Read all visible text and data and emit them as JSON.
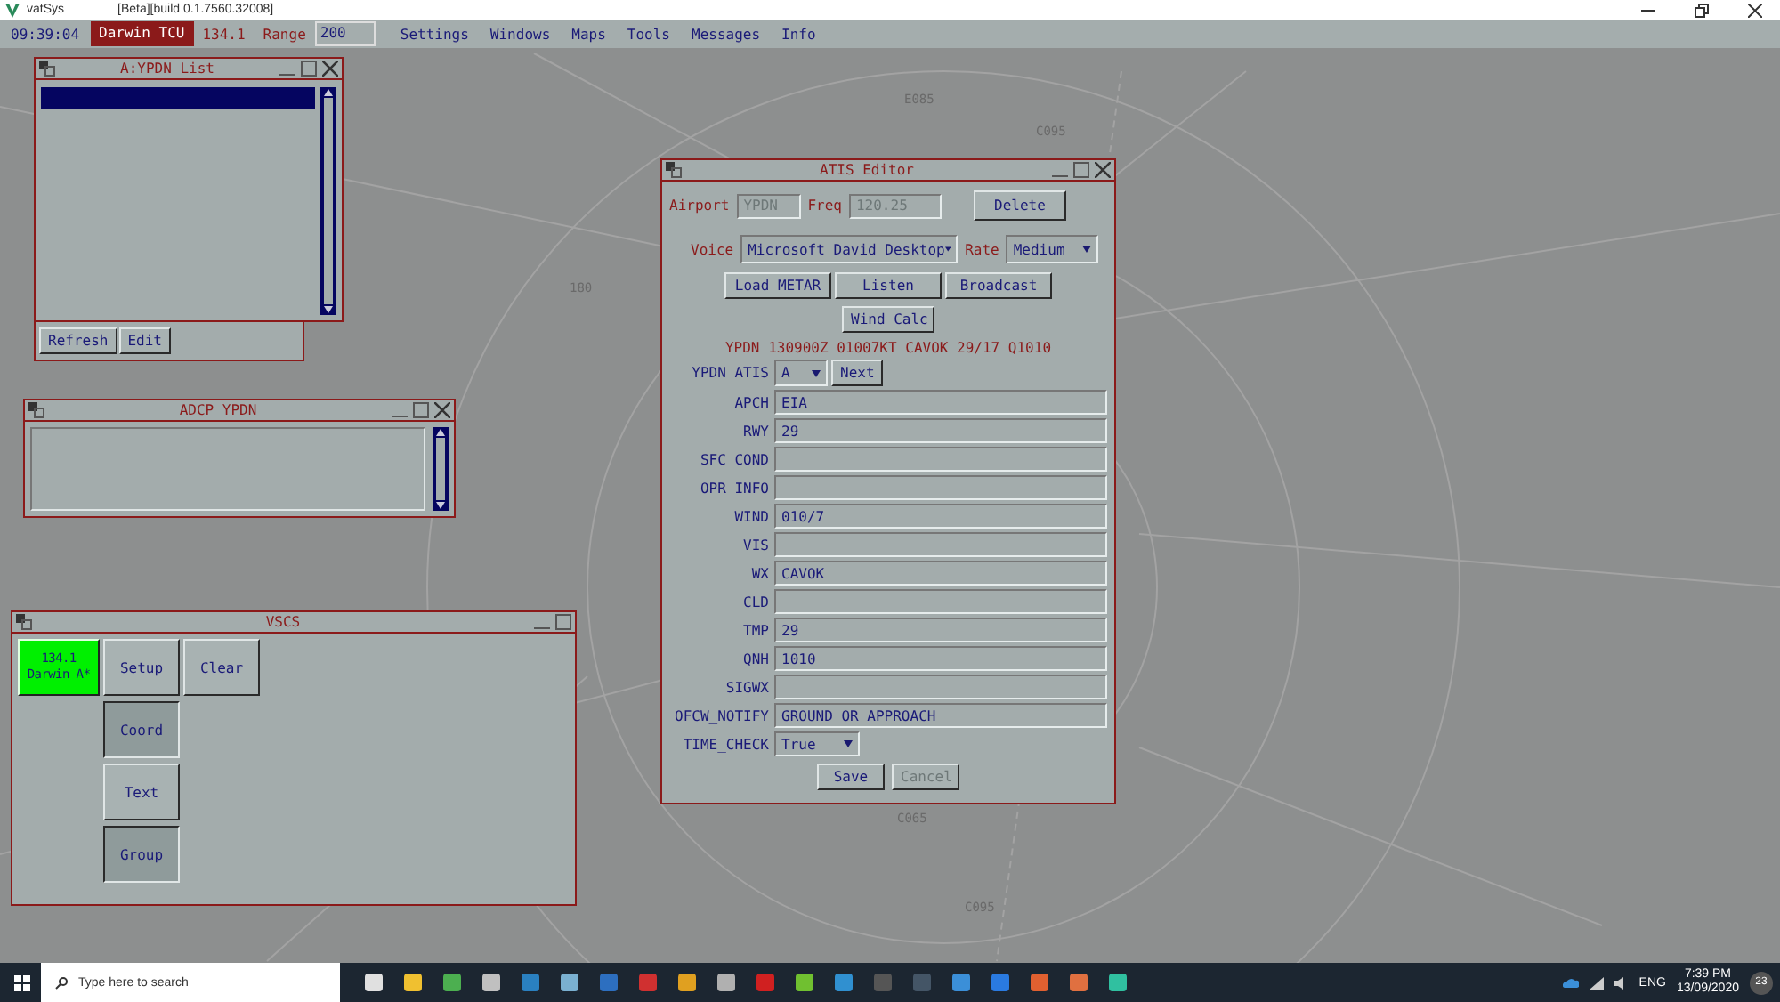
{
  "titlebar": {
    "app_name": "vatSys",
    "build": "[Beta][build 0.1.7560.32008]"
  },
  "menubar": {
    "time": "09:39:04",
    "position": "Darwin TCU",
    "frequency": "134.1",
    "range_label": "Range",
    "range_value": "200",
    "menus": [
      "Settings",
      "Windows",
      "Maps",
      "Tools",
      "Messages",
      "Info"
    ]
  },
  "map": {
    "labels": [
      "E085",
      "C095",
      "180",
      "C065",
      "C095"
    ]
  },
  "list_window": {
    "title": "A:YPDN List",
    "rows": [
      {
        "selected": true
      }
    ],
    "buttons": [
      "Refresh",
      "Edit"
    ]
  },
  "adcp_window": {
    "title": "ADCP YPDN"
  },
  "vscs": {
    "title": "VSCS",
    "frequency_tile": {
      "frequency": "134.1",
      "name": "Darwin A*",
      "active": true
    },
    "buttons": [
      {
        "label": "Setup",
        "selected": false
      },
      {
        "label": "Clear",
        "selected": false
      },
      {
        "label": "Coord",
        "selected": true
      },
      {
        "label": "Text",
        "selected": false
      },
      {
        "label": "Group",
        "selected": true
      }
    ]
  },
  "atis_editor": {
    "title": "ATIS Editor",
    "airport_label": "Airport",
    "airport": {
      "value": "YPDN",
      "disabled": true
    },
    "freq_label": "Freq",
    "freq": {
      "value": "120.25",
      "disabled": true
    },
    "delete_button": "Delete",
    "voice_label": "Voice",
    "voice": "Microsoft David Desktop",
    "rate_label": "Rate",
    "rate": "Medium",
    "action_buttons": [
      "Load METAR",
      "Listen",
      "Broadcast"
    ],
    "wind_calc_button": "Wind Calc",
    "metar": "YPDN 130900Z 01007KT CAVOK 29/17 Q1010",
    "atis_label": "YPDN ATIS",
    "atis_letter": "A",
    "next_button": "Next",
    "fields": [
      {
        "label": "APCH",
        "value": "EIA",
        "kind": "text"
      },
      {
        "label": "RWY",
        "value": "29",
        "kind": "text"
      },
      {
        "label": "SFC COND",
        "kind": "text"
      },
      {
        "label": "OPR INFO",
        "kind": "text"
      },
      {
        "label": "WIND",
        "value": "010/7",
        "kind": "text"
      },
      {
        "label": "VIS",
        "kind": "text"
      },
      {
        "label": "WX",
        "value": "CAVOK",
        "kind": "text"
      },
      {
        "label": "CLD",
        "kind": "text"
      },
      {
        "label": "TMP",
        "value": "29",
        "kind": "text"
      },
      {
        "label": "QNH",
        "value": "1010",
        "kind": "text"
      },
      {
        "label": "SIGWX",
        "kind": "text"
      },
      {
        "label": "OFCW_NOTIFY",
        "value": "GROUND OR APPROACH",
        "kind": "text"
      },
      {
        "label": "TIME_CHECK",
        "value": "True",
        "kind": "select"
      }
    ],
    "buttons": [
      {
        "label": "Save",
        "disabled": false
      },
      {
        "label": "Cancel",
        "disabled": true
      }
    ]
  },
  "taskbar": {
    "search_placeholder": "Type here to search",
    "language": "ENG",
    "time": "7:39 PM",
    "date": "13/09/2020",
    "notification_count": "23"
  }
}
